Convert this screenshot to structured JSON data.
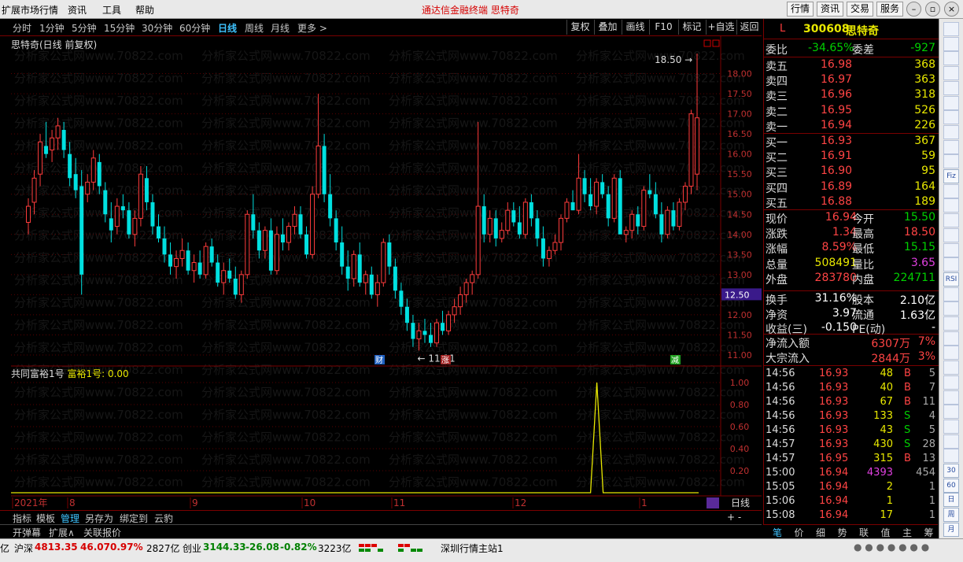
{
  "menu": {
    "items": [
      "扩展市场行情",
      "资讯",
      "工具",
      "帮助"
    ],
    "center_title": "通达信金融终端  思特奇",
    "right_buttons": [
      "行情",
      "资讯",
      "交易",
      "服务"
    ]
  },
  "period_bar": {
    "periods": [
      "分时",
      "1分钟",
      "5分钟",
      "15分钟",
      "30分钟",
      "60分钟",
      "日线",
      "周线",
      "月线",
      "更多 >"
    ],
    "active_index": 6,
    "tools": [
      "复权",
      "叠加",
      "画线",
      "F10",
      "标记",
      "+自选",
      "返回"
    ]
  },
  "chart": {
    "stock_title": "思特奇(日线 前复权)",
    "watermark": "分析家公式网www.70822.com",
    "price_ticks": [
      "18.00",
      "17.50",
      "17.00",
      "16.50",
      "16.00",
      "15.50",
      "15.00",
      "14.50",
      "14.00",
      "13.50",
      "13.00",
      "12.50",
      "12.00",
      "11.50",
      "11.00"
    ],
    "crosshair_price": "12.50",
    "high_label": "18.50",
    "low_label": "11.11",
    "event_markers": [
      "财",
      "涨",
      "减"
    ],
    "x_labels": [
      "2021年",
      "8",
      "9",
      "10",
      "11",
      "12",
      "1"
    ],
    "period_label": "日线"
  },
  "chart_data": {
    "type": "candlestick",
    "title": "思特奇(日线 前复权)",
    "y_range": [
      11.0,
      18.5
    ],
    "high": 18.5,
    "low": 11.11,
    "candles": [
      [
        14.3,
        14.9,
        14.0,
        14.7
      ],
      [
        14.8,
        15.6,
        14.5,
        15.4
      ],
      [
        15.5,
        16.5,
        15.2,
        16.3
      ],
      [
        16.2,
        16.8,
        15.9,
        16.0
      ],
      [
        16.1,
        16.6,
        15.8,
        16.4
      ],
      [
        16.4,
        16.9,
        16.1,
        16.7
      ],
      [
        16.6,
        16.8,
        15.9,
        16.1
      ],
      [
        16.0,
        16.3,
        15.2,
        15.4
      ],
      [
        15.5,
        15.9,
        14.9,
        15.1
      ],
      [
        15.2,
        15.6,
        12.5,
        13.0
      ],
      [
        15.0,
        15.5,
        14.8,
        15.3
      ],
      [
        15.3,
        16.1,
        15.1,
        15.9
      ],
      [
        15.8,
        16.0,
        15.0,
        15.2
      ],
      [
        15.1,
        15.3,
        14.3,
        14.5
      ],
      [
        14.4,
        14.8,
        13.8,
        14.1
      ],
      [
        14.2,
        14.9,
        14.0,
        14.7
      ],
      [
        14.7,
        15.0,
        14.4,
        14.6
      ],
      [
        14.6,
        14.8,
        13.9,
        14.0
      ],
      [
        14.0,
        14.6,
        13.7,
        14.4
      ],
      [
        14.4,
        15.7,
        14.2,
        15.5
      ],
      [
        15.4,
        15.7,
        14.6,
        14.8
      ],
      [
        14.8,
        15.0,
        14.0,
        14.2
      ],
      [
        14.2,
        14.5,
        13.8,
        13.9
      ],
      [
        13.9,
        14.2,
        13.3,
        13.5
      ],
      [
        13.5,
        13.8,
        13.0,
        13.2
      ],
      [
        13.2,
        13.6,
        12.9,
        13.4
      ],
      [
        13.4,
        13.9,
        13.2,
        13.6
      ],
      [
        13.6,
        13.8,
        13.0,
        13.1
      ],
      [
        13.1,
        13.5,
        12.8,
        13.3
      ],
      [
        13.3,
        13.6,
        12.9,
        13.0
      ],
      [
        13.0,
        13.8,
        12.9,
        13.7
      ],
      [
        13.7,
        13.9,
        13.2,
        13.3
      ],
      [
        13.3,
        13.5,
        12.7,
        12.8
      ],
      [
        12.8,
        13.3,
        12.5,
        13.1
      ],
      [
        13.1,
        13.4,
        12.8,
        12.9
      ],
      [
        12.9,
        13.2,
        12.4,
        12.5
      ],
      [
        12.5,
        13.1,
        12.3,
        13.0
      ],
      [
        13.0,
        14.6,
        12.9,
        14.5
      ],
      [
        14.5,
        15.0,
        13.9,
        14.1
      ],
      [
        14.1,
        14.3,
        13.4,
        13.6
      ],
      [
        13.6,
        14.2,
        13.4,
        14.1
      ],
      [
        14.1,
        14.4,
        13.0,
        13.1
      ],
      [
        13.1,
        14.2,
        13.0,
        14.0
      ],
      [
        14.0,
        14.4,
        13.6,
        13.8
      ],
      [
        13.8,
        14.3,
        13.6,
        14.2
      ],
      [
        14.2,
        14.7,
        14.0,
        14.5
      ],
      [
        14.5,
        14.7,
        13.9,
        14.0
      ],
      [
        14.0,
        14.2,
        13.4,
        13.5
      ],
      [
        13.5,
        15.2,
        13.4,
        15.0
      ],
      [
        15.0,
        17.5,
        14.9,
        16.2
      ],
      [
        16.2,
        16.5,
        14.8,
        15.0
      ],
      [
        15.0,
        15.5,
        14.2,
        14.4
      ],
      [
        14.4,
        14.6,
        13.6,
        13.8
      ],
      [
        13.8,
        14.2,
        13.0,
        13.2
      ],
      [
        13.2,
        13.6,
        12.6,
        12.9
      ],
      [
        12.9,
        13.6,
        12.7,
        13.5
      ],
      [
        13.5,
        13.8,
        12.7,
        12.8
      ],
      [
        12.8,
        13.1,
        12.5,
        13.0
      ],
      [
        13.0,
        13.2,
        12.4,
        12.5
      ],
      [
        12.5,
        13.0,
        12.2,
        12.8
      ],
      [
        12.8,
        13.9,
        12.7,
        13.8
      ],
      [
        13.8,
        14.0,
        13.0,
        13.2
      ],
      [
        13.2,
        13.4,
        12.4,
        12.6
      ],
      [
        12.6,
        12.8,
        12.0,
        12.2
      ],
      [
        12.2,
        12.4,
        11.6,
        11.8
      ],
      [
        11.8,
        12.0,
        11.2,
        11.4
      ],
      [
        11.4,
        11.8,
        11.11,
        11.6
      ],
      [
        11.6,
        11.9,
        11.3,
        11.5
      ],
      [
        11.5,
        11.8,
        11.2,
        11.3
      ],
      [
        11.3,
        11.9,
        11.2,
        11.8
      ],
      [
        11.8,
        12.1,
        11.5,
        11.6
      ],
      [
        11.6,
        12.1,
        11.5,
        12.0
      ],
      [
        12.0,
        12.4,
        11.8,
        12.2
      ],
      [
        12.2,
        12.7,
        12.0,
        12.5
      ],
      [
        12.5,
        12.9,
        12.3,
        12.8
      ],
      [
        12.8,
        13.1,
        12.5,
        13.0
      ],
      [
        13.0,
        16.8,
        12.9,
        14.7
      ],
      [
        14.7,
        15.0,
        13.8,
        14.0
      ],
      [
        14.0,
        14.6,
        13.8,
        14.4
      ],
      [
        14.4,
        14.6,
        13.7,
        13.9
      ],
      [
        13.9,
        14.3,
        13.8,
        14.1
      ],
      [
        14.1,
        14.8,
        14.0,
        14.6
      ],
      [
        14.6,
        14.8,
        14.2,
        14.3
      ],
      [
        14.3,
        14.7,
        13.9,
        14.0
      ],
      [
        14.0,
        14.9,
        13.9,
        14.8
      ],
      [
        14.8,
        15.0,
        14.2,
        14.4
      ],
      [
        14.4,
        14.6,
        13.7,
        13.9
      ],
      [
        13.9,
        14.2,
        13.2,
        13.4
      ],
      [
        13.4,
        13.7,
        13.2,
        13.6
      ],
      [
        13.6,
        14.0,
        13.5,
        13.8
      ],
      [
        13.8,
        14.5,
        13.6,
        14.4
      ],
      [
        14.4,
        14.9,
        14.3,
        14.8
      ],
      [
        14.8,
        15.1,
        14.6,
        14.6
      ],
      [
        14.6,
        16.0,
        14.5,
        15.4
      ],
      [
        15.4,
        15.6,
        14.8,
        15.0
      ],
      [
        15.0,
        15.4,
        14.6,
        14.7
      ],
      [
        14.7,
        15.4,
        14.5,
        15.3
      ],
      [
        15.3,
        15.5,
        14.9,
        15.0
      ],
      [
        15.0,
        15.2,
        14.2,
        14.4
      ],
      [
        14.4,
        15.5,
        14.3,
        15.4
      ],
      [
        15.4,
        15.6,
        14.3,
        14.0
      ],
      [
        14.0,
        14.2,
        13.8,
        14.1
      ],
      [
        14.1,
        14.6,
        13.9,
        14.5
      ],
      [
        14.5,
        14.7,
        14.0,
        14.2
      ],
      [
        14.2,
        15.2,
        14.1,
        15.1
      ],
      [
        15.1,
        15.5,
        14.9,
        15.0
      ],
      [
        15.0,
        15.3,
        14.4,
        14.5
      ],
      [
        14.5,
        14.8,
        13.8,
        14.0
      ],
      [
        14.0,
        14.7,
        13.9,
        14.6
      ],
      [
        14.6,
        14.8,
        14.1,
        14.2
      ],
      [
        14.2,
        14.9,
        14.1,
        14.8
      ],
      [
        14.8,
        15.3,
        14.6,
        15.2
      ],
      [
        15.2,
        17.1,
        15.0,
        17.0
      ],
      [
        15.5,
        18.5,
        15.1,
        16.9
      ]
    ],
    "indicator": {
      "name": "共同富裕1号",
      "series_name": "富裕1号",
      "current_value": "0.00",
      "y_ticks": [
        "1.00",
        "0.80",
        "0.60",
        "0.40",
        "0.20"
      ],
      "peak_index": 95,
      "peak_value": 1.0
    }
  },
  "quote": {
    "code": "300608",
    "name": "思特奇",
    "flag": "L",
    "weibi_label": "委比",
    "weibi": "-34.65%",
    "weicha_label": "委差",
    "weicha": "-927",
    "asks": [
      {
        "label": "卖五",
        "price": "16.98",
        "vol": "368"
      },
      {
        "label": "卖四",
        "price": "16.97",
        "vol": "363"
      },
      {
        "label": "卖三",
        "price": "16.96",
        "vol": "318"
      },
      {
        "label": "卖二",
        "price": "16.95",
        "vol": "526"
      },
      {
        "label": "卖一",
        "price": "16.94",
        "vol": "226"
      }
    ],
    "bids": [
      {
        "label": "买一",
        "price": "16.93",
        "vol": "367"
      },
      {
        "label": "买二",
        "price": "16.91",
        "vol": "59"
      },
      {
        "label": "买三",
        "price": "16.90",
        "vol": "95"
      },
      {
        "label": "买四",
        "price": "16.89",
        "vol": "164"
      },
      {
        "label": "买五",
        "price": "16.88",
        "vol": "189"
      }
    ],
    "stats": [
      {
        "l1": "现价",
        "v1": "16.94",
        "c1": "#ff4444",
        "l2": "今开",
        "v2": "15.50",
        "c2": "#00d000"
      },
      {
        "l1": "涨跌",
        "v1": "1.34",
        "c1": "#ff4444",
        "l2": "最高",
        "v2": "18.50",
        "c2": "#ff4444"
      },
      {
        "l1": "涨幅",
        "v1": "8.59%",
        "c1": "#ff4444",
        "l2": "最低",
        "v2": "15.15",
        "c2": "#00d000"
      },
      {
        "l1": "总量",
        "v1": "508491",
        "c1": "#e8e800",
        "l2": "量比",
        "v2": "3.65",
        "c2": "#e040e0"
      },
      {
        "l1": "外盘",
        "v1": "283780",
        "c1": "#ff4444",
        "l2": "内盘",
        "v2": "224711",
        "c2": "#00d000"
      }
    ],
    "stats2": [
      {
        "l1": "换手",
        "v1": "31.16%",
        "c1": "#ffffff",
        "l2": "股本",
        "v2": "2.10亿",
        "c2": "#ffffff"
      },
      {
        "l1": "净资",
        "v1": "3.97",
        "c1": "#ffffff",
        "l2": "流通",
        "v2": "1.63亿",
        "c2": "#ffffff"
      },
      {
        "l1": "收益(三)",
        "v1": "-0.150",
        "c1": "#ffffff",
        "l2": "PE(动)",
        "v2": "-",
        "c2": "#ffffff"
      }
    ],
    "flows": [
      {
        "label": "净流入额",
        "value": "6307万",
        "pct": "7%"
      },
      {
        "label": "大宗流入",
        "value": "2844万",
        "pct": "3%"
      }
    ],
    "ticks": [
      {
        "time": "14:56",
        "price": "16.93",
        "vol": "48",
        "vc": "#e8e800",
        "bs": "B",
        "n": "5"
      },
      {
        "time": "14:56",
        "price": "16.93",
        "vol": "40",
        "vc": "#e8e800",
        "bs": "B",
        "n": "7"
      },
      {
        "time": "14:56",
        "price": "16.93",
        "vol": "67",
        "vc": "#e8e800",
        "bs": "B",
        "n": "11"
      },
      {
        "time": "14:56",
        "price": "16.93",
        "vol": "133",
        "vc": "#e8e800",
        "bs": "S",
        "n": "4"
      },
      {
        "time": "14:56",
        "price": "16.93",
        "vol": "43",
        "vc": "#e8e800",
        "bs": "S",
        "n": "5"
      },
      {
        "time": "14:57",
        "price": "16.93",
        "vol": "430",
        "vc": "#e8e800",
        "bs": "S",
        "n": "28"
      },
      {
        "time": "14:57",
        "price": "16.95",
        "vol": "315",
        "vc": "#e8e800",
        "bs": "B",
        "n": "13"
      },
      {
        "time": "15:00",
        "price": "16.94",
        "vol": "4393",
        "vc": "#e040e0",
        "bs": "",
        "n": "454"
      },
      {
        "time": "15:05",
        "price": "16.94",
        "vol": "2",
        "vc": "#e8e800",
        "bs": "",
        "n": "1"
      },
      {
        "time": "15:06",
        "price": "16.94",
        "vol": "1",
        "vc": "#e8e800",
        "bs": "",
        "n": "1"
      },
      {
        "time": "15:08",
        "price": "16.94",
        "vol": "17",
        "vc": "#e8e800",
        "bs": "",
        "n": "1"
      }
    ],
    "tabs": [
      "笔",
      "价",
      "细",
      "势",
      "联",
      "值",
      "主",
      "筹"
    ]
  },
  "side_tools": [
    "",
    "",
    "",
    "",
    "",
    "",
    "",
    "",
    "",
    "",
    "Fiz",
    "",
    "",
    "",
    "",
    "",
    "",
    "RSI",
    "",
    "",
    "",
    "",
    "",
    "",
    "",
    "",
    "",
    "",
    "",
    "",
    "30",
    "60",
    "日",
    "周",
    "月"
  ],
  "bottom_tabs": [
    "指标",
    "模板",
    "管理",
    "另存为",
    "绑定到",
    "云豹"
  ],
  "bottom_tabs_active": 2,
  "sub_tabs": [
    "开弹幕",
    "扩展∧",
    "关联报价"
  ],
  "status": {
    "prefix": "亿",
    "idx1_name": "沪深",
    "idx1_val": "4813.35",
    "idx1_chg": "46.07",
    "idx1_pct": "0.97%",
    "idx1_amt": "2827亿",
    "idx2_name": "创业",
    "idx2_val": "3144.33",
    "idx2_chg": "-26.08",
    "idx2_pct": "-0.82%",
    "idx2_amt": "3223亿",
    "server": "深圳行情主站1"
  },
  "colors": {
    "up": "#ff3c3c",
    "down": "#00e0e0",
    "grid": "#7a0000",
    "accent": "#e8e800"
  }
}
